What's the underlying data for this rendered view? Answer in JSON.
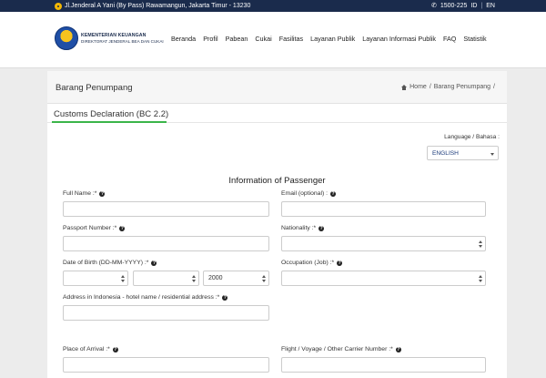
{
  "topbar": {
    "address": "Jl.Jenderal A Yani (By Pass) Rawamangun, Jakarta Timur - 13230",
    "phone_icon": "phone-icon",
    "phone": "1500-225",
    "lang_id": "ID",
    "lang_sep": "|",
    "lang_en": "EN"
  },
  "header": {
    "logo_line1": "KEMENTERIAN KEUANGAN",
    "logo_line2": "DIREKTORAT JENDERAL BEA DAN CUKAI",
    "nav": [
      "Beranda",
      "Profil",
      "Pabean",
      "Cukai",
      "Fasilitas",
      "Layanan Publik",
      "Layanan Informasi Publik",
      "FAQ",
      "Statistik"
    ]
  },
  "page": {
    "title": "Barang Penumpang",
    "breadcrumb_home": "Home",
    "breadcrumb_sep1": "/",
    "breadcrumb_current": "Barang Penumpang",
    "breadcrumb_sep2": "/"
  },
  "tab": {
    "title": "Customs Declaration (BC 2.2)"
  },
  "language": {
    "label": "Language / Bahasa :",
    "value": "ENGLISH"
  },
  "form": {
    "section_title": "Information of Passenger",
    "full_name_label": "Full Name :*",
    "email_label": "Email (optional) :",
    "passport_label": "Passport Number :*",
    "nationality_label": "Nationality :*",
    "dob_label": "Date of Birth (DD-MM-YYYY) :*",
    "dob_year": "2000",
    "occupation_label": "Occupation (Job) :*",
    "address_label": "Address in Indonesia - hotel name / residential address :*",
    "arrival_label": "Place of Arrival :*",
    "flight_label": "Flight / Voyage / Other Carrier Number :*",
    "help_glyph": "?"
  },
  "colors": {
    "topbar": "#1a2b4c",
    "accent_green": "#3bb54a"
  }
}
